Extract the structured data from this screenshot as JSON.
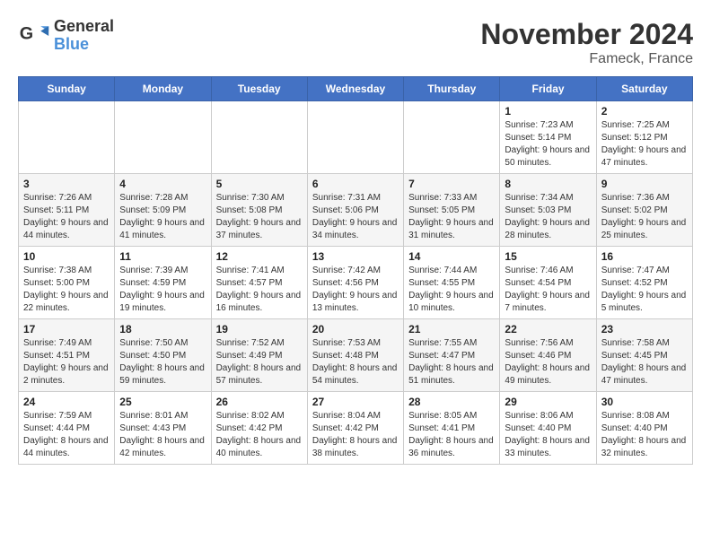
{
  "header": {
    "logo_line1": "General",
    "logo_line2": "Blue",
    "title": "November 2024",
    "subtitle": "Fameck, France"
  },
  "weekdays": [
    "Sunday",
    "Monday",
    "Tuesday",
    "Wednesday",
    "Thursday",
    "Friday",
    "Saturday"
  ],
  "weeks": [
    [
      {
        "day": "",
        "info": ""
      },
      {
        "day": "",
        "info": ""
      },
      {
        "day": "",
        "info": ""
      },
      {
        "day": "",
        "info": ""
      },
      {
        "day": "",
        "info": ""
      },
      {
        "day": "1",
        "info": "Sunrise: 7:23 AM\nSunset: 5:14 PM\nDaylight: 9 hours\nand 50 minutes."
      },
      {
        "day": "2",
        "info": "Sunrise: 7:25 AM\nSunset: 5:12 PM\nDaylight: 9 hours\nand 47 minutes."
      }
    ],
    [
      {
        "day": "3",
        "info": "Sunrise: 7:26 AM\nSunset: 5:11 PM\nDaylight: 9 hours\nand 44 minutes."
      },
      {
        "day": "4",
        "info": "Sunrise: 7:28 AM\nSunset: 5:09 PM\nDaylight: 9 hours\nand 41 minutes."
      },
      {
        "day": "5",
        "info": "Sunrise: 7:30 AM\nSunset: 5:08 PM\nDaylight: 9 hours\nand 37 minutes."
      },
      {
        "day": "6",
        "info": "Sunrise: 7:31 AM\nSunset: 5:06 PM\nDaylight: 9 hours\nand 34 minutes."
      },
      {
        "day": "7",
        "info": "Sunrise: 7:33 AM\nSunset: 5:05 PM\nDaylight: 9 hours\nand 31 minutes."
      },
      {
        "day": "8",
        "info": "Sunrise: 7:34 AM\nSunset: 5:03 PM\nDaylight: 9 hours\nand 28 minutes."
      },
      {
        "day": "9",
        "info": "Sunrise: 7:36 AM\nSunset: 5:02 PM\nDaylight: 9 hours\nand 25 minutes."
      }
    ],
    [
      {
        "day": "10",
        "info": "Sunrise: 7:38 AM\nSunset: 5:00 PM\nDaylight: 9 hours\nand 22 minutes."
      },
      {
        "day": "11",
        "info": "Sunrise: 7:39 AM\nSunset: 4:59 PM\nDaylight: 9 hours\nand 19 minutes."
      },
      {
        "day": "12",
        "info": "Sunrise: 7:41 AM\nSunset: 4:57 PM\nDaylight: 9 hours\nand 16 minutes."
      },
      {
        "day": "13",
        "info": "Sunrise: 7:42 AM\nSunset: 4:56 PM\nDaylight: 9 hours\nand 13 minutes."
      },
      {
        "day": "14",
        "info": "Sunrise: 7:44 AM\nSunset: 4:55 PM\nDaylight: 9 hours\nand 10 minutes."
      },
      {
        "day": "15",
        "info": "Sunrise: 7:46 AM\nSunset: 4:54 PM\nDaylight: 9 hours\nand 7 minutes."
      },
      {
        "day": "16",
        "info": "Sunrise: 7:47 AM\nSunset: 4:52 PM\nDaylight: 9 hours\nand 5 minutes."
      }
    ],
    [
      {
        "day": "17",
        "info": "Sunrise: 7:49 AM\nSunset: 4:51 PM\nDaylight: 9 hours\nand 2 minutes."
      },
      {
        "day": "18",
        "info": "Sunrise: 7:50 AM\nSunset: 4:50 PM\nDaylight: 8 hours\nand 59 minutes."
      },
      {
        "day": "19",
        "info": "Sunrise: 7:52 AM\nSunset: 4:49 PM\nDaylight: 8 hours\nand 57 minutes."
      },
      {
        "day": "20",
        "info": "Sunrise: 7:53 AM\nSunset: 4:48 PM\nDaylight: 8 hours\nand 54 minutes."
      },
      {
        "day": "21",
        "info": "Sunrise: 7:55 AM\nSunset: 4:47 PM\nDaylight: 8 hours\nand 51 minutes."
      },
      {
        "day": "22",
        "info": "Sunrise: 7:56 AM\nSunset: 4:46 PM\nDaylight: 8 hours\nand 49 minutes."
      },
      {
        "day": "23",
        "info": "Sunrise: 7:58 AM\nSunset: 4:45 PM\nDaylight: 8 hours\nand 47 minutes."
      }
    ],
    [
      {
        "day": "24",
        "info": "Sunrise: 7:59 AM\nSunset: 4:44 PM\nDaylight: 8 hours\nand 44 minutes."
      },
      {
        "day": "25",
        "info": "Sunrise: 8:01 AM\nSunset: 4:43 PM\nDaylight: 8 hours\nand 42 minutes."
      },
      {
        "day": "26",
        "info": "Sunrise: 8:02 AM\nSunset: 4:42 PM\nDaylight: 8 hours\nand 40 minutes."
      },
      {
        "day": "27",
        "info": "Sunrise: 8:04 AM\nSunset: 4:42 PM\nDaylight: 8 hours\nand 38 minutes."
      },
      {
        "day": "28",
        "info": "Sunrise: 8:05 AM\nSunset: 4:41 PM\nDaylight: 8 hours\nand 36 minutes."
      },
      {
        "day": "29",
        "info": "Sunrise: 8:06 AM\nSunset: 4:40 PM\nDaylight: 8 hours\nand 33 minutes."
      },
      {
        "day": "30",
        "info": "Sunrise: 8:08 AM\nSunset: 4:40 PM\nDaylight: 8 hours\nand 32 minutes."
      }
    ]
  ]
}
